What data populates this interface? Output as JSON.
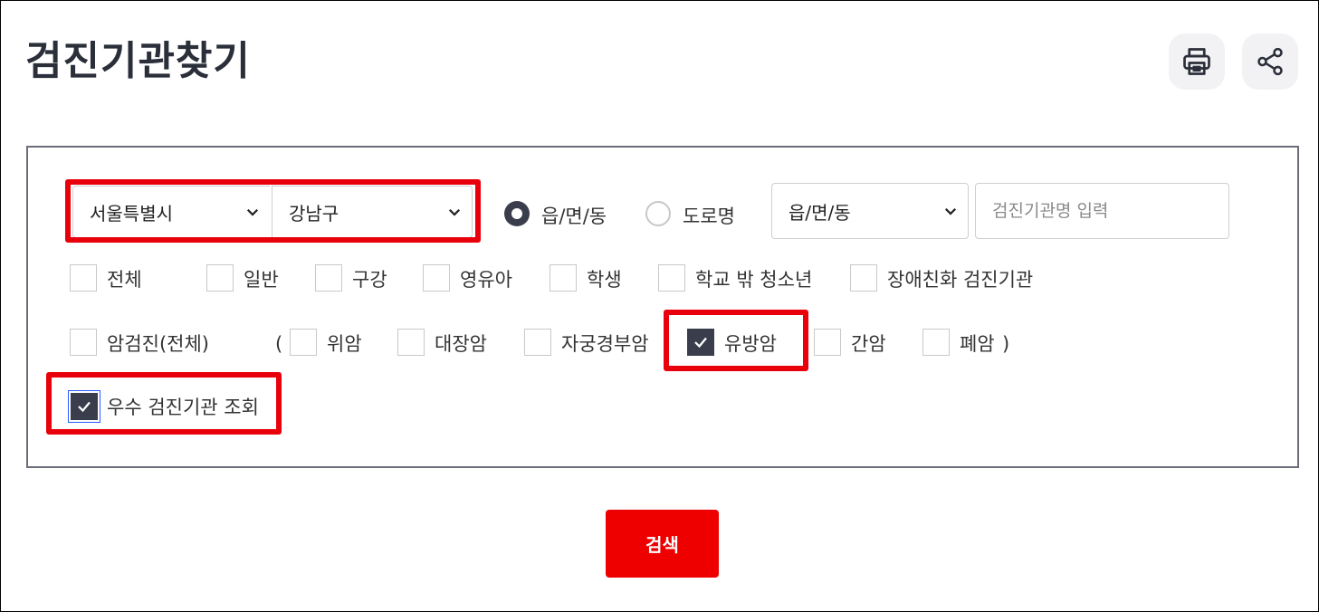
{
  "page": {
    "title": "검진기관찾기"
  },
  "actions": {
    "print_icon": "printer-icon",
    "share_icon": "share-icon"
  },
  "filters": {
    "sido": {
      "selected": "서울특별시"
    },
    "gugun": {
      "selected": "강남구"
    },
    "address_type": [
      {
        "label": "읍/면/동",
        "checked": true
      },
      {
        "label": "도로명",
        "checked": false
      }
    ],
    "dong": {
      "selected": "읍/면/동"
    },
    "name_search": {
      "placeholder": "검진기관명 입력",
      "value": ""
    },
    "categories": [
      {
        "label": "전체",
        "checked": false
      },
      {
        "label": "일반",
        "checked": false
      },
      {
        "label": "구강",
        "checked": false
      },
      {
        "label": "영유아",
        "checked": false
      },
      {
        "label": "학생",
        "checked": false
      },
      {
        "label": "학교 밖 청소년",
        "checked": false
      },
      {
        "label": "장애친화 검진기관",
        "checked": false
      }
    ],
    "cancer": {
      "all_label": "암검진(전체)",
      "all_checked": false,
      "open_paren": "(",
      "close_paren": ")",
      "types": [
        {
          "label": "위암",
          "checked": false
        },
        {
          "label": "대장암",
          "checked": false
        },
        {
          "label": "자궁경부암",
          "checked": false
        },
        {
          "label": "유방암",
          "checked": true
        },
        {
          "label": "간암",
          "checked": false
        },
        {
          "label": "폐암",
          "checked": false
        }
      ]
    },
    "excellent": {
      "label": "우수 검진기관 조회",
      "checked": true
    }
  },
  "search_button": {
    "label": "검색"
  },
  "colors": {
    "accent_red": "#ee0000",
    "highlight_red": "#e8000b",
    "checked_fill": "#3a3d4c"
  }
}
